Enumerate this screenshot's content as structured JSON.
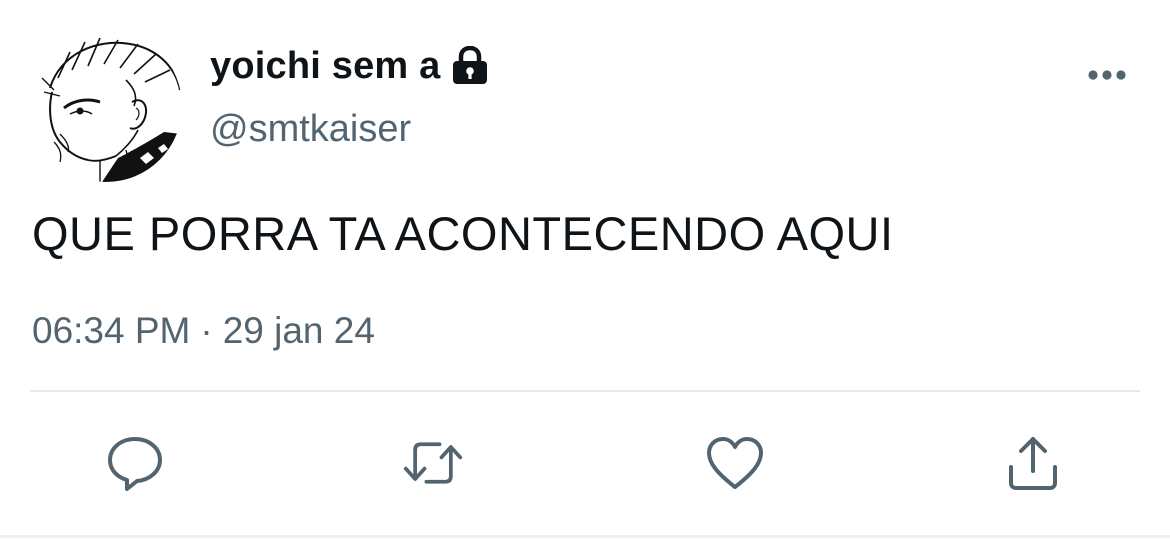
{
  "author": {
    "display_name": "yoichi sem a",
    "handle": "@smtkaiser",
    "protected": true,
    "avatar_icon": "manga-character-avatar"
  },
  "tweet": {
    "text": "QUE PORRA TA ACONTECENDO AQUI",
    "time": "06:34 PM",
    "separator": "·",
    "date": "29 jan 24"
  },
  "menu": {
    "more_icon": "ellipsis-icon"
  },
  "actions": [
    {
      "name": "reply",
      "icon": "speech-bubble-icon"
    },
    {
      "name": "retweet",
      "icon": "retweet-arrows-icon"
    },
    {
      "name": "like",
      "icon": "heart-icon"
    },
    {
      "name": "share",
      "icon": "upload-share-icon"
    }
  ],
  "colors": {
    "text_primary": "#0f1419",
    "text_secondary": "#536471",
    "divider": "#e6e9eb"
  }
}
